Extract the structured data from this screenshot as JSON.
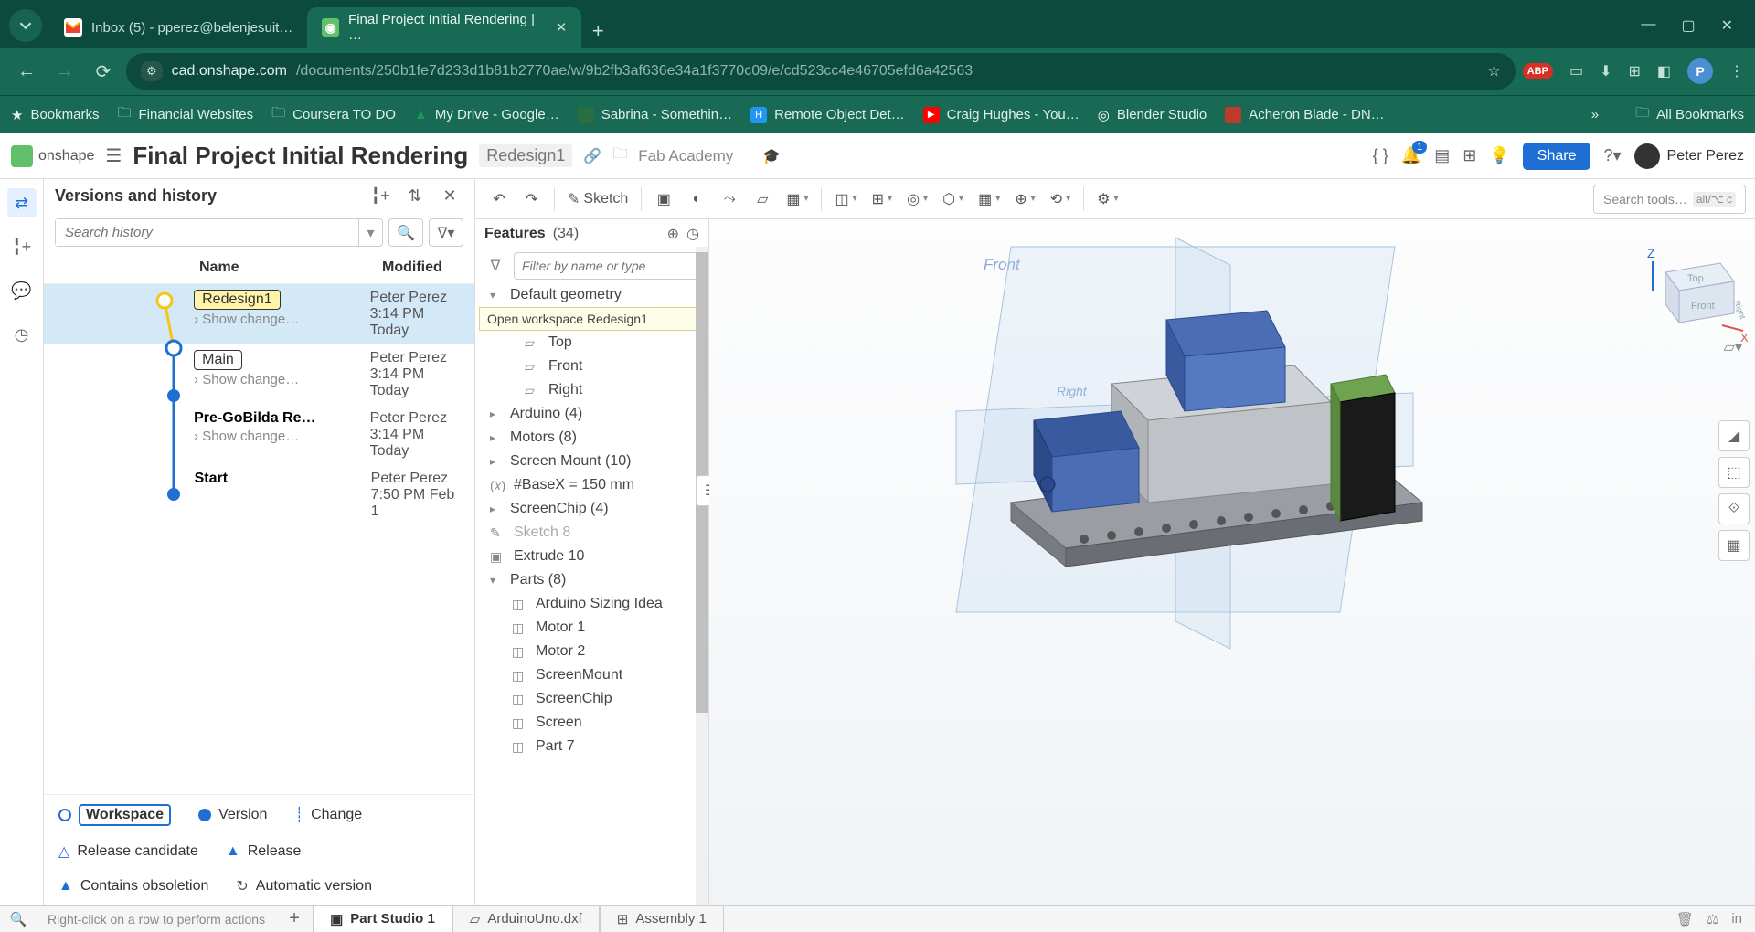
{
  "browser": {
    "tabs": [
      {
        "title": "Inbox (5) - pperez@belenjesuit…",
        "favicon": "M"
      },
      {
        "title": "Final Project Initial Rendering | …",
        "favicon": "O"
      }
    ],
    "url_host": "cad.onshape.com",
    "url_path": "/documents/250b1fe7d233d1b81b2770ae/w/9b2fb3af636e34a1f3770c09/e/cd523cc4e46705efd6a42563",
    "ext_abp": "ABP",
    "avatar_letter": "P"
  },
  "bookmarks": {
    "star": "Bookmarks",
    "items": [
      "Financial Websites",
      "Coursera TO DO",
      "My Drive - Google…",
      "Sabrina - Somethin…",
      "Remote Object Det…",
      "Craig Hughes - You…",
      "Blender Studio",
      "Acheron Blade - DN…"
    ],
    "all": "All Bookmarks"
  },
  "onshape": {
    "logo_text": "onshape",
    "doc_title": "Final Project Initial Rendering",
    "branch": "Redesign1",
    "folder": "Fab Academy",
    "notif_count": "1",
    "share": "Share",
    "user": "Peter Perez"
  },
  "versions": {
    "title": "Versions and history",
    "search_placeholder": "Search history",
    "columns": {
      "name": "Name",
      "modified": "Modified"
    },
    "rows": [
      {
        "label": "Redesign1",
        "yellow": true,
        "author": "Peter Perez",
        "time": "3:14 PM Today",
        "show": "Show change…"
      },
      {
        "label": "Main",
        "yellow": false,
        "author": "Peter Perez",
        "time": "3:14 PM Today",
        "show": "Show change…"
      },
      {
        "label": "Pre-GoBilda Re…",
        "plain": true,
        "author": "Peter Perez",
        "time": "3:14 PM Today",
        "show": "Show change…"
      },
      {
        "label": "Start",
        "plain": true,
        "author": "Peter Perez",
        "time": "7:50 PM Feb 1",
        "show": ""
      }
    ],
    "legend": {
      "workspace": "Workspace",
      "version": "Version",
      "change": "Change",
      "release_candidate": "Release candidate",
      "release": "Release",
      "obsoletion": "Contains obsoletion",
      "auto_version": "Automatic version"
    },
    "tooltip": "Open workspace Redesign1"
  },
  "features": {
    "header": "Features",
    "count": "(34)",
    "filter_placeholder": "Filter by name or type",
    "items": [
      {
        "t": "folder-open",
        "label": "Default geometry"
      },
      {
        "t": "tooltip",
        "label": "Open workspace Redesign1"
      },
      {
        "t": "plane",
        "label": "Top",
        "sub": 2
      },
      {
        "t": "plane",
        "label": "Front",
        "sub": 2
      },
      {
        "t": "plane",
        "label": "Right",
        "sub": 2
      },
      {
        "t": "folder",
        "label": "Arduino (4)"
      },
      {
        "t": "folder",
        "label": "Motors (8)"
      },
      {
        "t": "folder",
        "label": "Screen Mount (10)"
      },
      {
        "t": "var",
        "label": "#BaseX = 150 mm"
      },
      {
        "t": "folder",
        "label": "ScreenChip (4)"
      },
      {
        "t": "sketch",
        "label": "Sketch 8",
        "muted": true
      },
      {
        "t": "extrude",
        "label": "Extrude 10"
      },
      {
        "t": "folder-open",
        "label": "Parts (8)"
      },
      {
        "t": "part",
        "label": "Arduino Sizing Idea",
        "sub": 1
      },
      {
        "t": "part",
        "label": "Motor 1",
        "sub": 1
      },
      {
        "t": "part",
        "label": "Motor 2",
        "sub": 1
      },
      {
        "t": "part",
        "label": "ScreenMount",
        "sub": 1
      },
      {
        "t": "part",
        "label": "ScreenChip",
        "sub": 1
      },
      {
        "t": "part",
        "label": "Screen",
        "sub": 1
      },
      {
        "t": "part",
        "label": "Part 7",
        "sub": 1
      }
    ]
  },
  "toolbar": {
    "sketch": "Sketch",
    "search_label": "Search tools…",
    "search_hint": "alt/⌥ c"
  },
  "canvas": {
    "front": "Front",
    "right": "Right",
    "cube_top": "Top",
    "cube_front": "Front",
    "cube_right": "Right",
    "z": "Z",
    "x": "X"
  },
  "bottom": {
    "help": "Right-click on a row to perform actions",
    "tabs": [
      "Part Studio 1",
      "ArduinoUno.dxf",
      "Assembly 1"
    ]
  }
}
